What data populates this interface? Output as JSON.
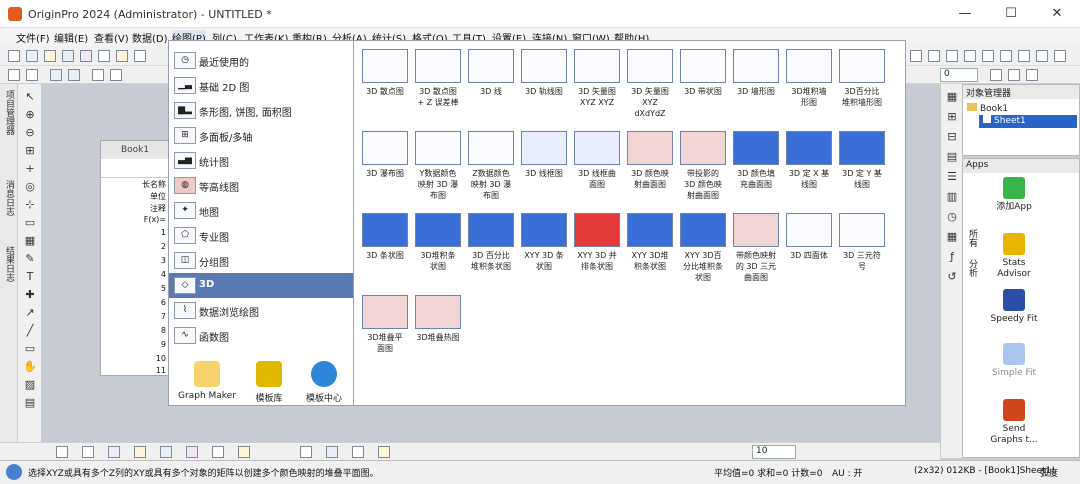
{
  "window": {
    "title": "OriginPro 2024 (Administrator) - UNTITLED *",
    "minimize": "—",
    "maximize": "☐",
    "close": "✕"
  },
  "menus": [
    "文件(F)",
    "编辑(E)",
    "查看(V)",
    "数据(D)",
    "绘图(P)",
    "列(C)",
    "工作表(K)",
    "重构(R)",
    "分析(A)",
    "统计(S)",
    "格式(O)",
    "工具(T)",
    "设置(E)",
    "连接(N)",
    "窗口(W)",
    "帮助(H)"
  ],
  "left_vtabs": [
    "项目管理器",
    "消息日志",
    "结果日志"
  ],
  "book1": {
    "title": "Book1",
    "row_labels": [
      "长名称",
      "单位",
      "注释",
      "F(x)=",
      "1",
      "2",
      "3",
      "4",
      "5",
      "6",
      "7",
      "8",
      "9",
      "10",
      "11"
    ]
  },
  "plot_menu": {
    "categories": [
      {
        "label": "最近使用的",
        "icon": "recent-icon"
      },
      {
        "label": "基础 2D 图",
        "icon": "basic-2d-icon"
      },
      {
        "label": "条形图, 饼图, 面积图",
        "icon": "bar-pie-area-icon"
      },
      {
        "label": "多面板/多轴",
        "icon": "multi-panel-icon"
      },
      {
        "label": "统计图",
        "icon": "statistics-icon"
      },
      {
        "label": "等高线图",
        "icon": "contour-icon"
      },
      {
        "label": "地图",
        "icon": "map-icon"
      },
      {
        "label": "专业图",
        "icon": "specialized-icon"
      },
      {
        "label": "分组图",
        "icon": "grouped-icon"
      },
      {
        "label": "3D",
        "icon": "3d-icon"
      },
      {
        "label": "数据浏览绘图",
        "icon": "data-explore-icon"
      },
      {
        "label": "函数图",
        "icon": "function-icon"
      }
    ],
    "selected": "3D",
    "bottom_buttons": [
      "Graph Maker",
      "模板库",
      "模板中心"
    ]
  },
  "gallery_items": [
    "3D 散点图",
    "3D 散点图\n+ Z 误差棒",
    "3D 线",
    "3D 轨线图",
    "3D 矢量图\nXYZ XYZ",
    "3D 矢量图\nXYZ\ndXdYdZ",
    "3D 带状图",
    "3D 墙形图",
    "3D堆积墙\n形图",
    "3D百分比\n堆积墙形图",
    "3D 瀑布图",
    "Y数据颜色\n映射 3D 瀑\n布图",
    "Z数据颜色\n映射 3D 瀑\n布图",
    "3D 线框图",
    "3D 线框曲\n面图",
    "3D 颜色映\n射曲面图",
    "带投影的\n3D 颜色映\n射曲面图",
    "3D 颜色填\n充曲面图",
    "3D 定 X 基\n线图",
    "3D 定 Y 基\n线图",
    "3D 条状图",
    "3D堆积条\n状图",
    "3D 百分比\n堆积条状图",
    "XYY 3D 条\n状图",
    "XYY 3D 并\n排条状图",
    "XYY 3D堆\n积条状图",
    "XYY 3D百\n分比堆积条\n状图",
    "带颜色映射\n的 3D 三元\n曲面图",
    "3D 四面体",
    "3D 三元符\n号",
    "3D堆叠平\n面图",
    "3D堆叠热图"
  ],
  "object_manager": {
    "title": "对象管理器",
    "book": "Book1",
    "sheet": "Sheet1"
  },
  "apps": {
    "title": "Apps",
    "side_tabs": [
      "所有",
      "分析"
    ],
    "items": [
      "添加App",
      "Stats\nAdvisor",
      "Speedy Fit",
      "Simple Fit",
      "Send\nGraphs t..."
    ]
  },
  "bottom_toolbar": {
    "line_width": "10"
  },
  "toolbar2": {
    "zoom": "0"
  },
  "statusbar": {
    "message": "选择XYZ或具有多个Z列的XY或具有多个对象的矩阵以创建多个颜色映射的堆叠平面图。",
    "stats": "平均值=0 求和=0 计数=0",
    "au": "AU : 开",
    "dims": "(2x32) 0",
    "mem": "12KB - [Book1]Sheet1!",
    "angle": "弧度"
  },
  "colors": {
    "selected_category": "#5a7bb1",
    "title_bar": "#ffffff",
    "workspace": "#c7ccd4"
  }
}
